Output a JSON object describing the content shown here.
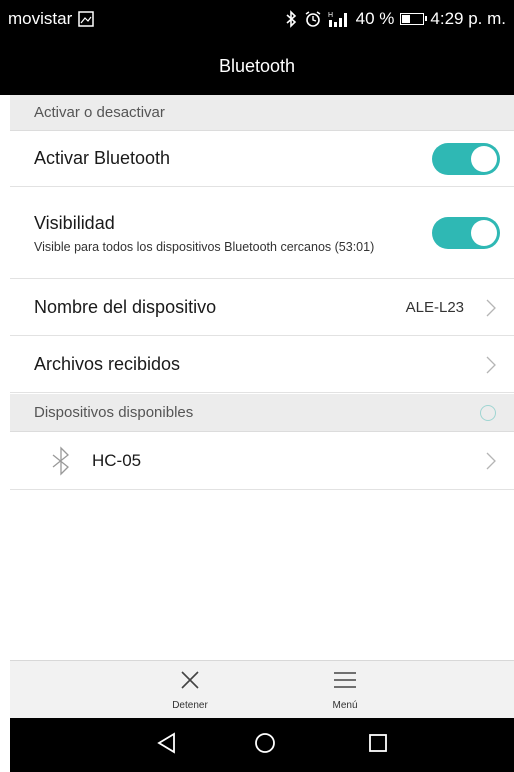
{
  "status_bar": {
    "carrier": "movistar",
    "battery_text": "40 %",
    "battery_level": 0.4,
    "time": "4:29 p. m."
  },
  "title_bar": {
    "title": "Bluetooth"
  },
  "section_toggle": {
    "label": "Activar o desactivar"
  },
  "activar_bluetooth": {
    "title": "Activar Bluetooth",
    "enabled": true
  },
  "visibilidad": {
    "title": "Visibilidad",
    "subtitle": "Visible para todos los dispositivos Bluetooth cercanos (53:01)",
    "enabled": true
  },
  "device_name": {
    "title": "Nombre del dispositivo",
    "value": "ALE-L23"
  },
  "received_files": {
    "title": "Archivos recibidos"
  },
  "section_devices": {
    "label": "Dispositivos disponibles"
  },
  "devices": [
    {
      "name": "HC-05",
      "icon": "bluetooth-icon"
    }
  ],
  "bottom_bar": {
    "stop_label": "Detener",
    "menu_label": "Menú"
  },
  "colors": {
    "accent": "#2fb8b4",
    "header_bg": "#ececec",
    "bar_bg": "#000000"
  }
}
